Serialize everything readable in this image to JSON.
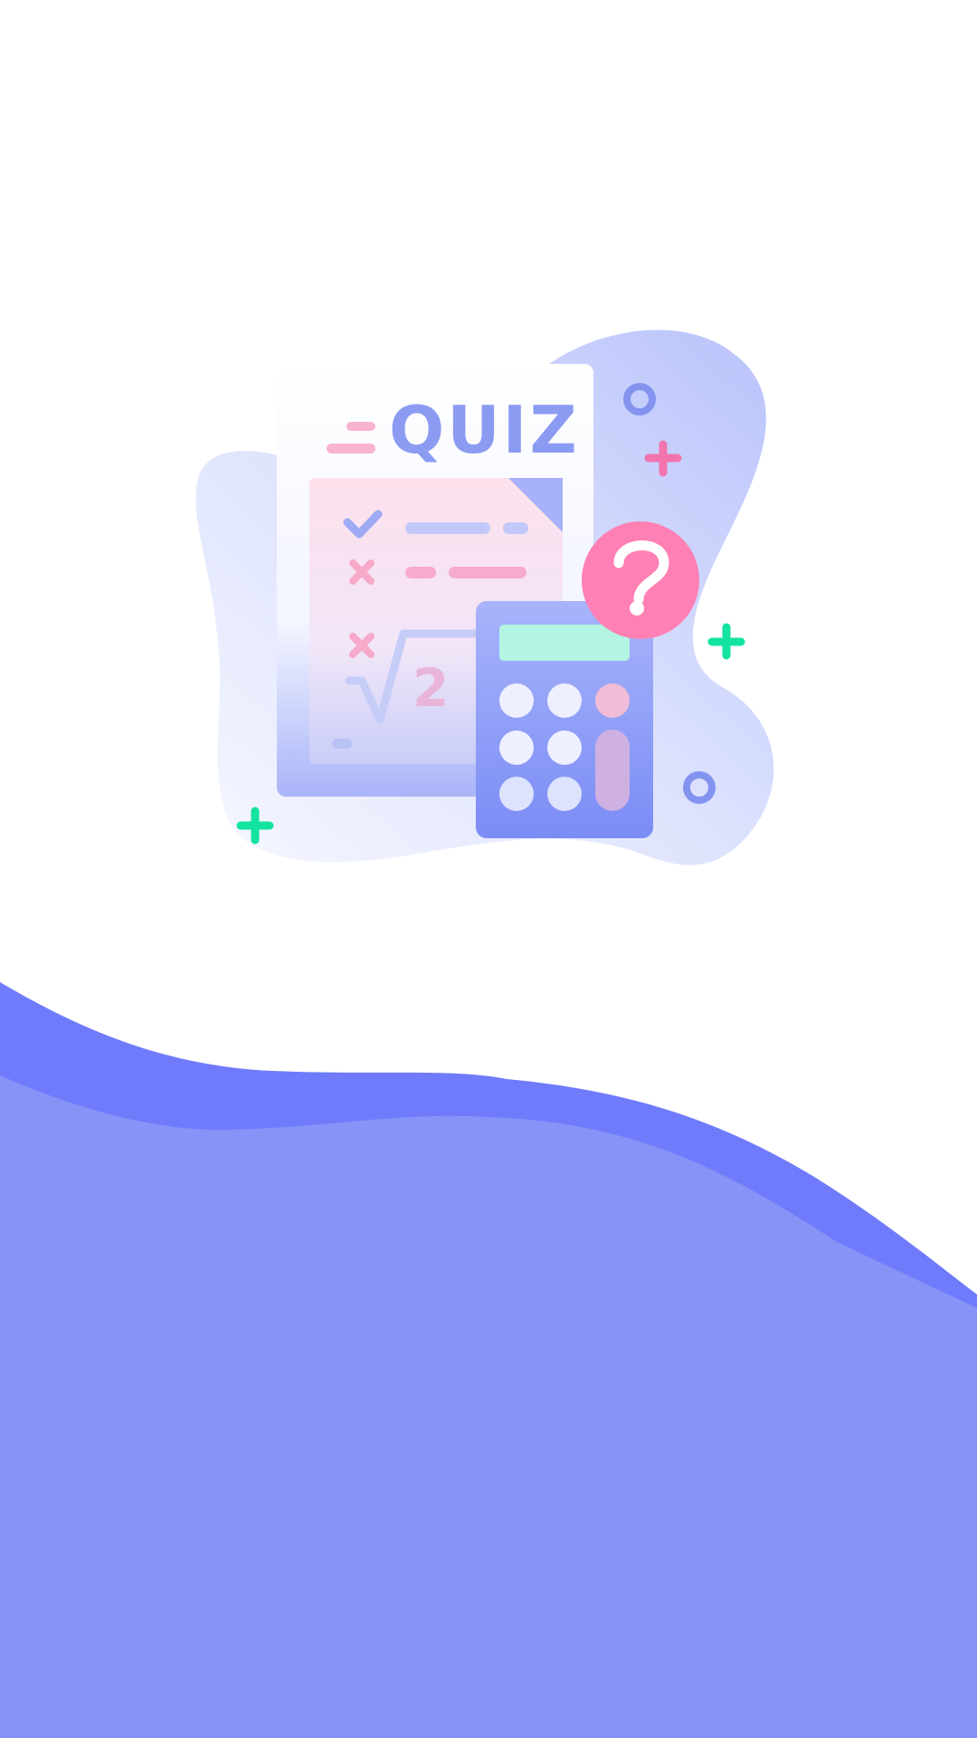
{
  "screen": {
    "name": "quiz-splash-screen"
  },
  "illustration": {
    "title_text": "QUIZ",
    "question_mark": "?",
    "math_symbol": "√",
    "math_exponent": "2",
    "icons": [
      "quiz-document-icon",
      "calculator-icon",
      "question-badge-icon",
      "check-icon",
      "cross-icon",
      "sparkle-icon",
      "ring-icon"
    ]
  },
  "colors": {
    "background": "#ffffff",
    "wave_dark": "#6f7bfb",
    "wave_light": "#8793f7",
    "blob": "#c5cdfc",
    "accent_pink": "#ff7fb5",
    "accent_green": "#13e3a0",
    "accent_blue": "#7f8ff5"
  }
}
